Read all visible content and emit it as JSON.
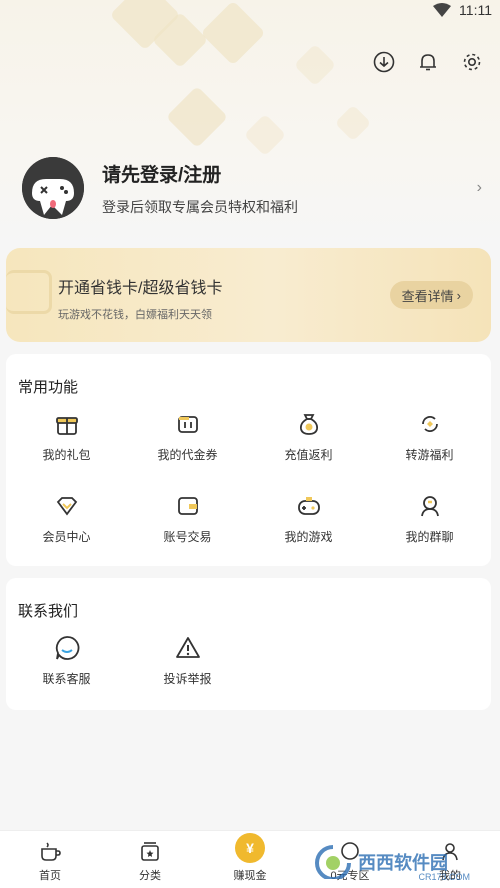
{
  "status_bar": {
    "time": "11:11"
  },
  "profile": {
    "title": "请先登录/注册",
    "subtitle": "登录后领取专属会员特权和福利"
  },
  "vip_card": {
    "title": "开通省钱卡/超级省钱卡",
    "subtitle": "玩游戏不花钱，白嫖福利天天领",
    "button": "查看详情"
  },
  "common": {
    "title": "常用功能",
    "items": [
      {
        "label": "我的礼包",
        "icon": "gift-icon"
      },
      {
        "label": "我的代金券",
        "icon": "voucher-icon"
      },
      {
        "label": "充值返利",
        "icon": "money-bag-icon"
      },
      {
        "label": "转游福利",
        "icon": "transfer-icon"
      },
      {
        "label": "会员中心",
        "icon": "diamond-icon"
      },
      {
        "label": "账号交易",
        "icon": "wallet-icon"
      },
      {
        "label": "我的游戏",
        "icon": "gamepad-icon"
      },
      {
        "label": "我的群聊",
        "icon": "group-chat-icon"
      }
    ]
  },
  "contact": {
    "title": "联系我们",
    "items": [
      {
        "label": "联系客服",
        "icon": "chat-bubble-icon"
      },
      {
        "label": "投诉举报",
        "icon": "warning-icon"
      }
    ]
  },
  "bottom_nav": {
    "items": [
      {
        "label": "首页",
        "icon": "home-cup-icon"
      },
      {
        "label": "分类",
        "icon": "category-box-icon"
      },
      {
        "label": "赚现金",
        "icon": "coin-bag-icon"
      },
      {
        "label": "0元专区",
        "icon": "zero-zone-icon"
      },
      {
        "label": "我的",
        "icon": "me-icon"
      }
    ],
    "coin_symbol": "¥"
  },
  "watermark": {
    "text": "西西软件园",
    "small": "CR173.COM"
  },
  "colors": {
    "accent": "#f0b92e",
    "vip_bg": "#f6e6bd",
    "brand_blue": "#2d6fb4"
  }
}
